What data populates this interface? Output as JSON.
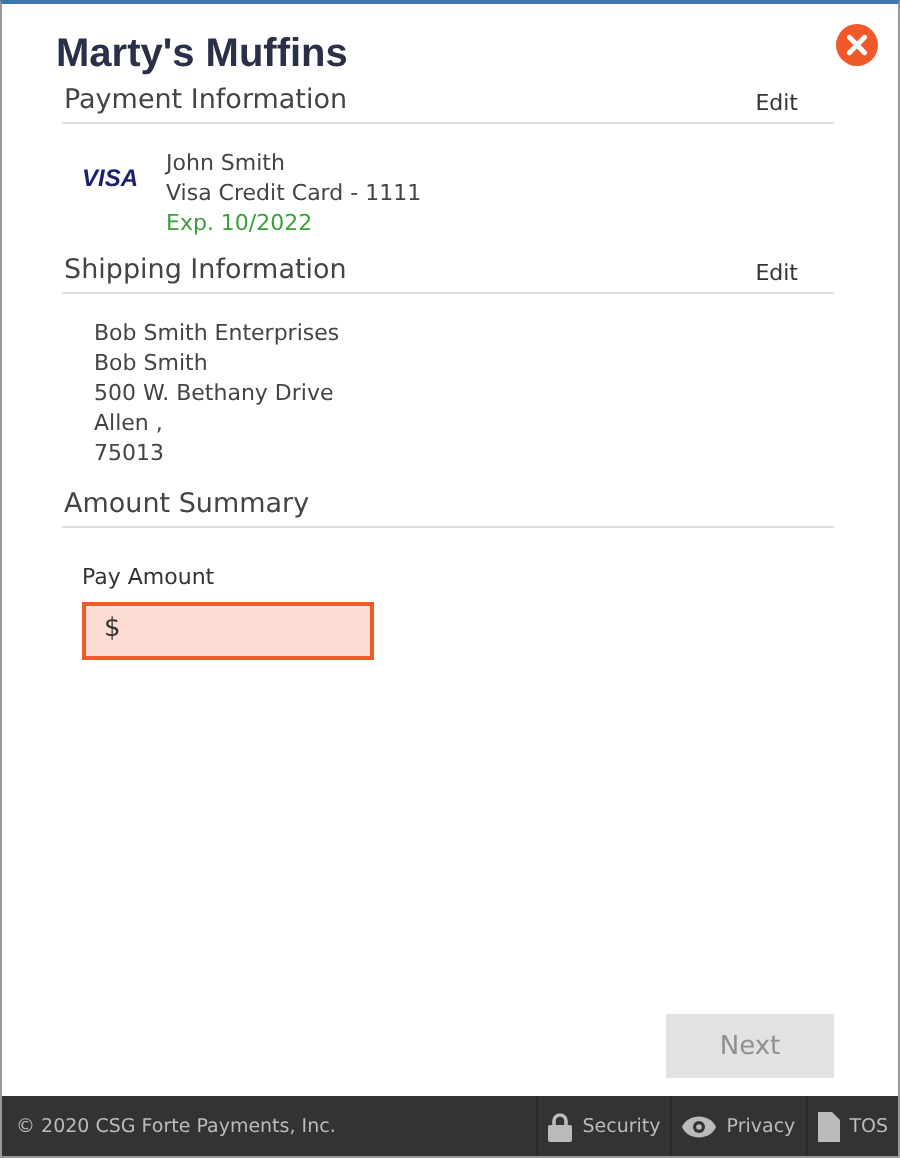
{
  "title": "Marty's Muffins",
  "payment": {
    "heading": "Payment Information",
    "edit": "Edit",
    "card_brand": "VISA",
    "lines": [
      {
        "text": "John Smith",
        "kind": "plain"
      },
      {
        "text": "Visa Credit Card - 1111",
        "kind": "plain"
      },
      {
        "text": "Exp. 10/2022",
        "kind": "valid"
      }
    ]
  },
  "shipping": {
    "heading": "Shipping Information",
    "edit": "Edit",
    "lines": [
      "Bob Smith Enterprises",
      "Bob Smith",
      "500 W. Bethany Drive",
      "Allen ,",
      "75013"
    ]
  },
  "amount": {
    "heading": "Amount Summary",
    "label": "Pay Amount",
    "prefix": "$",
    "invalid": true
  },
  "next_button": {
    "label": "Next",
    "disabled": true
  },
  "footer": {
    "copyright": "© 2020 CSG Forte Payments, Inc.",
    "links": [
      {
        "label": "Security",
        "kind": "lock"
      },
      {
        "label": "Privacy",
        "kind": "eye"
      },
      {
        "label": "TOS",
        "kind": "doc"
      }
    ]
  }
}
